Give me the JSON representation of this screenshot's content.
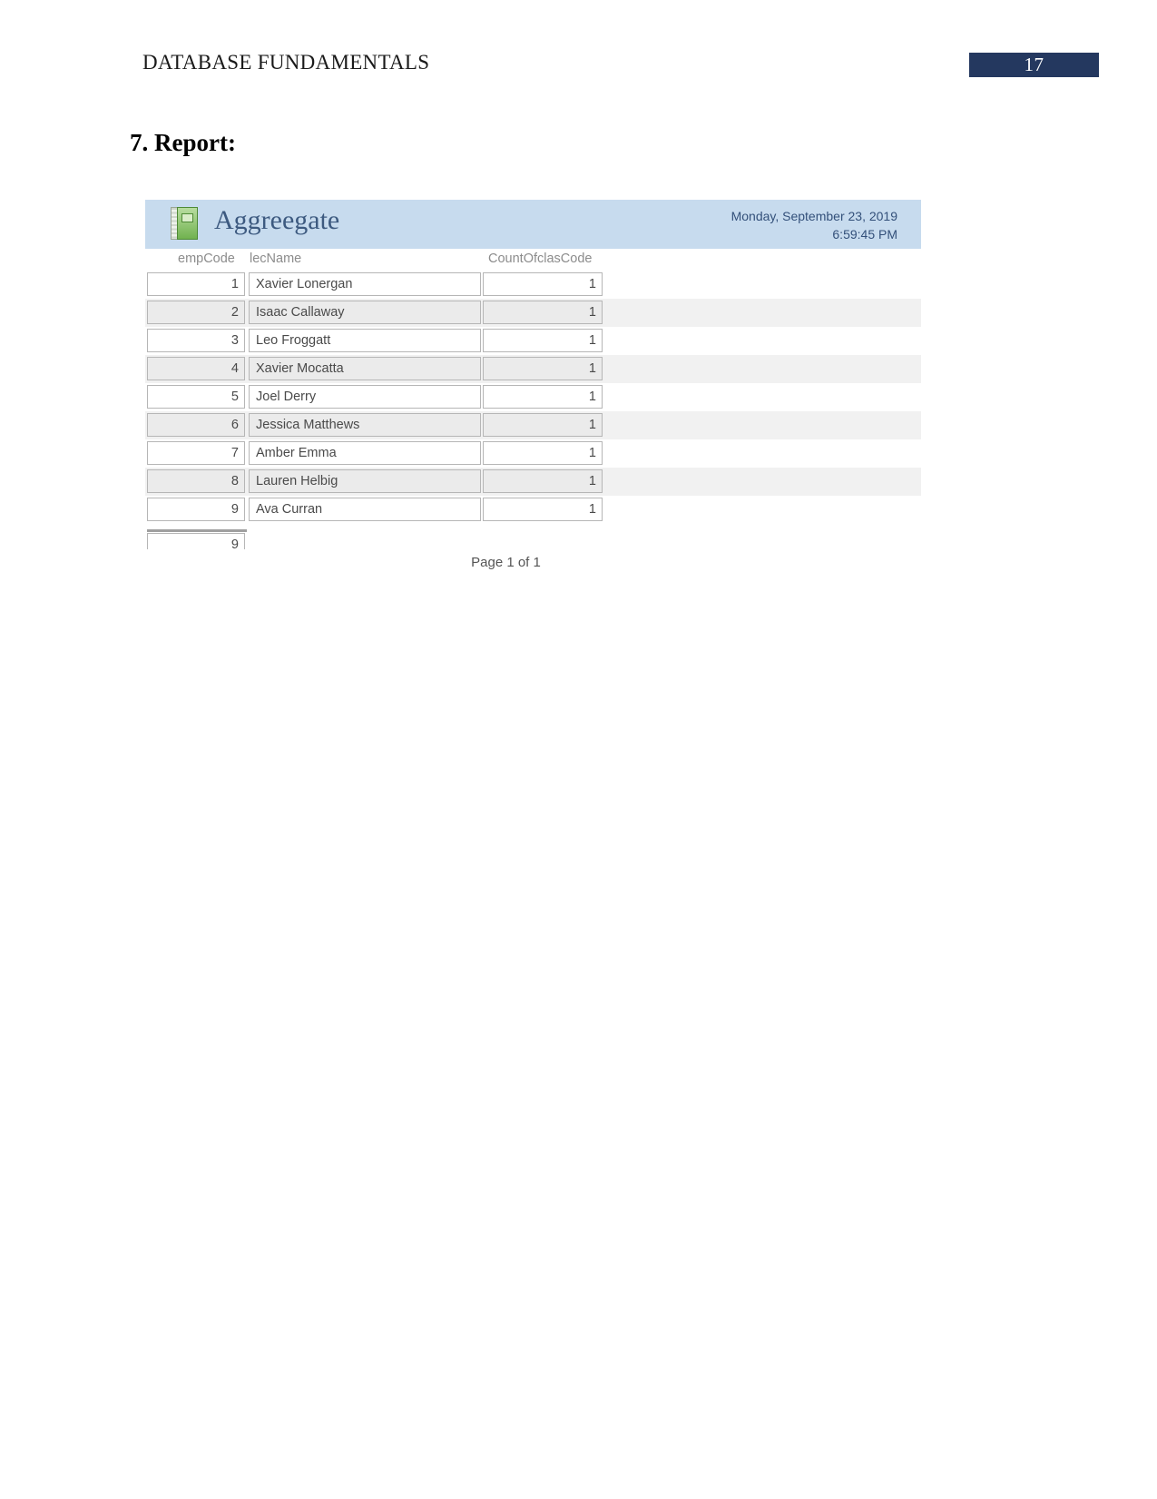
{
  "document": {
    "header_title": "DATABASE FUNDAMENTALS",
    "page_number": "17",
    "badge_color": "#24385f",
    "section_heading": "7. Report:"
  },
  "report": {
    "icon": "green-report-book-icon",
    "title": "Aggreegate",
    "title_color": "#3d5a80",
    "header_background": "#c7dbee",
    "date": "Monday, September 23, 2019",
    "time": "6:59:45 PM",
    "columns": [
      {
        "key": "empCode",
        "label": "empCode",
        "align": "right"
      },
      {
        "key": "lecName",
        "label": "lecName",
        "align": "left"
      },
      {
        "key": "CountOfclasCode",
        "label": "CountOfclasCode",
        "align": "right"
      }
    ],
    "rows": [
      {
        "empCode": "1",
        "lecName": "Xavier Lonergan",
        "count": "1"
      },
      {
        "empCode": "2",
        "lecName": "Isaac Callaway",
        "count": "1"
      },
      {
        "empCode": "3",
        "lecName": "Leo Froggatt",
        "count": "1"
      },
      {
        "empCode": "4",
        "lecName": "Xavier Mocatta",
        "count": "1"
      },
      {
        "empCode": "5",
        "lecName": "Joel Derry",
        "count": "1"
      },
      {
        "empCode": "6",
        "lecName": "Jessica Matthews",
        "count": "1"
      },
      {
        "empCode": "7",
        "lecName": "Amber Emma",
        "count": "1"
      },
      {
        "empCode": "8",
        "lecName": "Lauren Helbig",
        "count": "1"
      },
      {
        "empCode": "9",
        "lecName": "Ava Curran",
        "count": "1"
      }
    ],
    "total": "9",
    "page_of": "Page 1 of 1"
  }
}
